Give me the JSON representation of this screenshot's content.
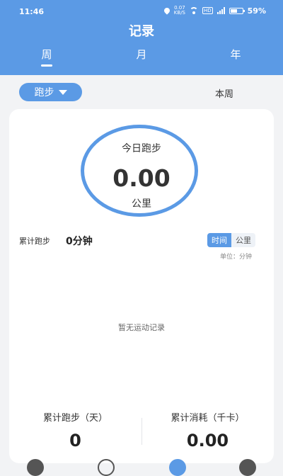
{
  "status_bar": {
    "time": "11:46",
    "speed_value": "0.07",
    "speed_unit": "KB/S",
    "hd": "HD",
    "battery": "59%",
    "battery_level": 0.59
  },
  "header": {
    "title": "记录",
    "tabs": [
      {
        "label": "周"
      },
      {
        "label": "月"
      },
      {
        "label": "年"
      }
    ],
    "active_tab": 0
  },
  "filter": {
    "sport_type": "跑步",
    "period": "本周"
  },
  "ring": {
    "label": "今日跑步",
    "value": "0.00",
    "unit": "公里"
  },
  "summary": {
    "label": "累计跑步",
    "value": "0分钟"
  },
  "toggle": {
    "time": "时间",
    "distance": "公里",
    "selected": "时间"
  },
  "unit_note": "单位：分钟",
  "empty_text": "暂无运动记录",
  "stats": {
    "left": {
      "label": "累计跑步（天）",
      "value": "0"
    },
    "right": {
      "label": "累计消耗（千卡）",
      "value": "0.00"
    }
  },
  "colors": {
    "accent": "#5b9ae5",
    "background": "#f2f3f5"
  },
  "bottom_nav": [
    {
      "icon": "run-icon"
    },
    {
      "icon": "compass-icon"
    },
    {
      "icon": "record-icon"
    },
    {
      "icon": "profile-icon"
    }
  ]
}
